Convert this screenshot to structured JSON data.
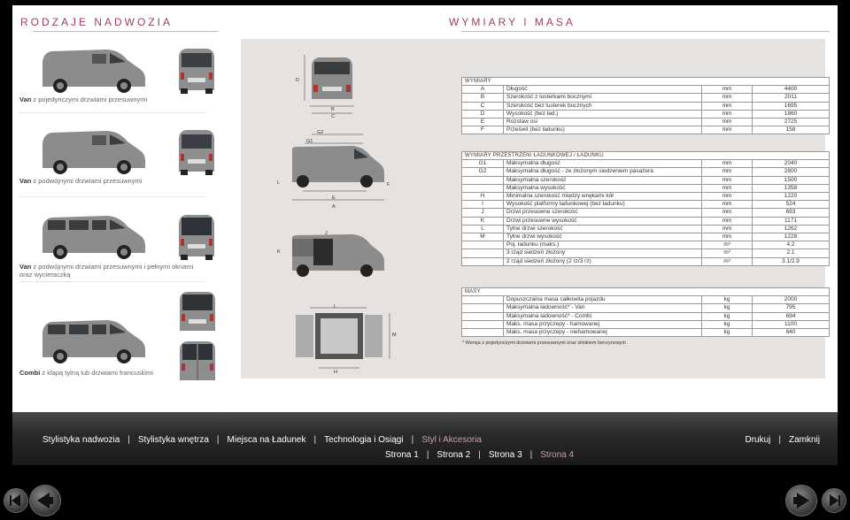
{
  "headings": {
    "left": "RODZAJE NADWOZIA",
    "right": "WYMIARY I MASA"
  },
  "variants": [
    {
      "bold": "Van",
      "rest": " z pojedynczymi drzwiami przesuwnymi"
    },
    {
      "bold": "Van",
      "rest": " z podwójnymi drzwiami przesuwnymi"
    },
    {
      "bold": "Van",
      "rest": " z podwójnymi drzwiami przesuwnymi i pełnymi oknami oraz wycieraczką"
    },
    {
      "bold": "Combi",
      "rest": " z klapą tylną lub drzwiami francuskimi"
    }
  ],
  "diagram_letters": {
    "D": "D",
    "B": "B",
    "C": "C",
    "G2": "G2",
    "G1": "G1",
    "L": "L",
    "F": "F",
    "E": "E",
    "A": "A",
    "K": "K",
    "J": "J",
    "L2": "L",
    "M": "M",
    "H": "H"
  },
  "tables": {
    "wymiary": {
      "title": "WYMIARY",
      "rows": [
        {
          "code": "A",
          "name": "Długość",
          "unit": "mm",
          "value": "4400"
        },
        {
          "code": "B",
          "name": "Szerokość z lusterkami bocznymi",
          "unit": "mm",
          "value": "2011"
        },
        {
          "code": "C",
          "name": "Szerokość bez lusterek bocznych",
          "unit": "mm",
          "value": "1695"
        },
        {
          "code": "D",
          "name": "Wysokość (bez ład.)",
          "unit": "mm",
          "value": "1860"
        },
        {
          "code": "E",
          "name": "Rozstaw osi",
          "unit": "mm",
          "value": "2725"
        },
        {
          "code": "F",
          "name": "Prześwit (bez ładunku)",
          "unit": "mm",
          "value": "158"
        }
      ]
    },
    "przestrzen": {
      "title": "WYMIARY PRZESTRZENI ŁADUNKOWEJ / ŁADUNKU",
      "rows": [
        {
          "code": "G1",
          "name": "Maksymalna długość",
          "unit": "mm",
          "value": "2040"
        },
        {
          "code": "G2",
          "name": "Maksymalna długość - ze złożonym siedzeniem pasażera",
          "unit": "mm",
          "value": "2800"
        },
        {
          "code": "",
          "name": "Maksymalna szerokość",
          "unit": "mm",
          "value": "1500"
        },
        {
          "code": "",
          "name": "Maksymalna wysokość",
          "unit": "mm",
          "value": "1358"
        },
        {
          "code": "H",
          "name": "Minimalna szerokość między wnękami kół",
          "unit": "mm",
          "value": "1220"
        },
        {
          "code": "I",
          "name": "Wysokość platformy ładunkowej (bez ładunku)",
          "unit": "mm",
          "value": "524"
        },
        {
          "code": "J",
          "name": "Drzwi przesuwne szerokość",
          "unit": "mm",
          "value": "693"
        },
        {
          "code": "K",
          "name": "Drzwi przesuwne wysokość",
          "unit": "mm",
          "value": "1171"
        },
        {
          "code": "L",
          "name": "Tylne drzwi szerokość",
          "unit": "mm",
          "value": "1262"
        },
        {
          "code": "M",
          "name": "Tylne drzwi wysokość",
          "unit": "mm",
          "value": "1228"
        },
        {
          "code": "",
          "name": "Poj. ładunku (maks.)",
          "unit": "m³",
          "value": "4.2"
        },
        {
          "code": "",
          "name": "3 rząd siedzeń złożony",
          "unit": "m³",
          "value": "2.1"
        },
        {
          "code": "",
          "name": "2 rząd siedzeń złożony (2 rz/3 rz)",
          "unit": "m³",
          "value": "3.1/2.9"
        }
      ]
    },
    "masy": {
      "title": "MASY",
      "rows": [
        {
          "code": "",
          "name": "Dopuszczalna masa całkowita pojazdu",
          "unit": "kg",
          "value": "2000"
        },
        {
          "code": "",
          "name": "Maksymalna ładowność* - Van",
          "unit": "kg",
          "value": "795"
        },
        {
          "code": "",
          "name": "Maksymalna ładowność* - Combi",
          "unit": "kg",
          "value": "694"
        },
        {
          "code": "",
          "name": "Maks. masa przyczepy - hamowanej",
          "unit": "kg",
          "value": "1100"
        },
        {
          "code": "",
          "name": "Maks. masa przyczepy - niehamowanej",
          "unit": "kg",
          "value": "640"
        }
      ]
    }
  },
  "footnote": "* Wersja z pojedynczymi drzwiami przesuwnymi oraz silnikiem benzynowym",
  "nav": {
    "main": [
      "Stylistyka nadwozia",
      "Stylistyka wnętrza",
      "Miejsca na Ładunek",
      "Technologia i Osiągi",
      "Styl i Akcesoria"
    ],
    "pages": [
      "Strona 1",
      "Strona 2",
      "Strona 3",
      "Strona 4"
    ],
    "right": [
      "Drukuj",
      "Zamknij"
    ]
  },
  "colors": {
    "accent": "#9c3f5d",
    "active_nav": "#c8a0a6",
    "panel": "#e6e2df"
  }
}
